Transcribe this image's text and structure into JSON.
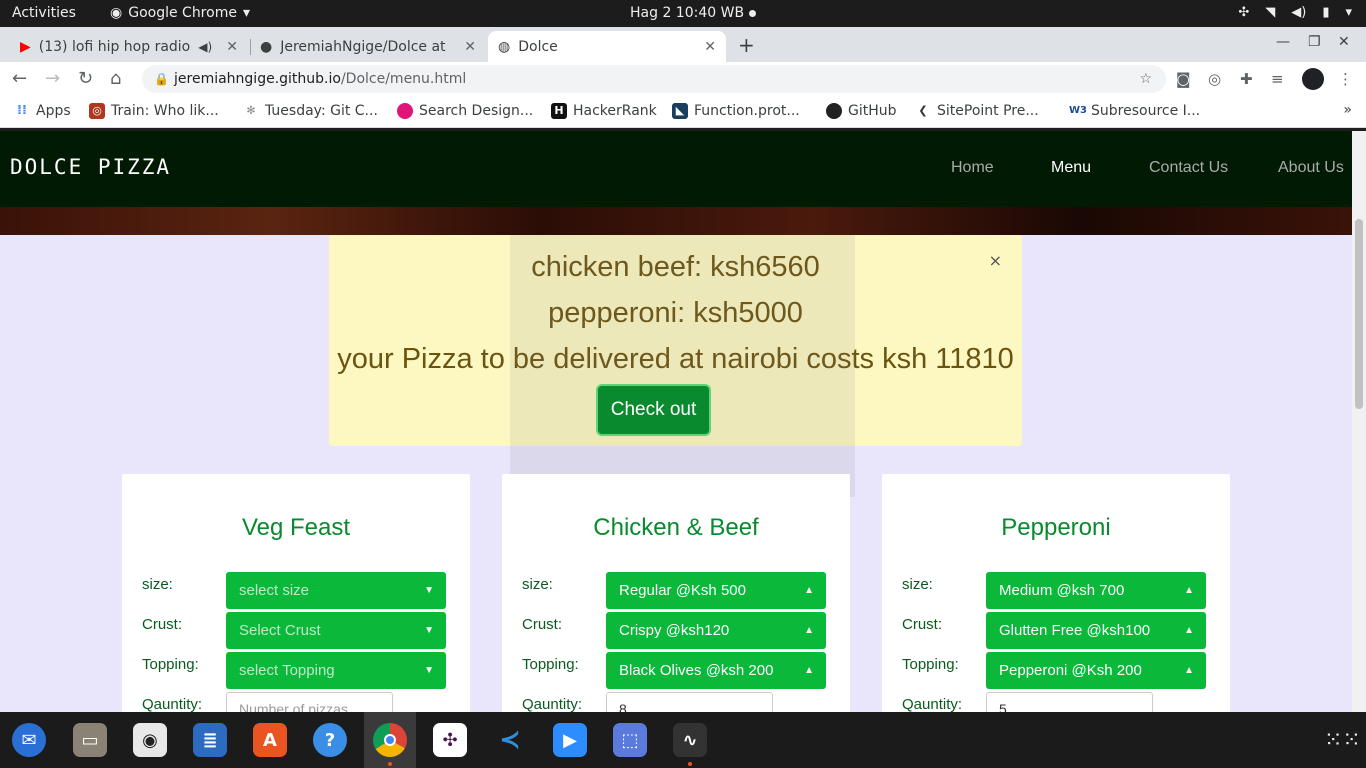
{
  "topbar": {
    "activities": "Activities",
    "app_name": "Google Chrome",
    "clock": "Hag 2  10:40 WB"
  },
  "tabs": [
    {
      "title": "(13) lofi hip hop radio",
      "active": false
    },
    {
      "title": "JeremiahNgige/Dolce at",
      "active": false
    },
    {
      "title": "Dolce",
      "active": true
    }
  ],
  "address": {
    "domain": "jeremiahngige.github.io",
    "path": "/Dolce/menu.html"
  },
  "bookmarks": [
    {
      "label": "Apps",
      "icon": "apps-grid-icon"
    },
    {
      "label": "Train: Who lik...",
      "icon": "codewars-icon"
    },
    {
      "label": "Tuesday: Git C...",
      "icon": "moringa-icon"
    },
    {
      "label": "Search Design...",
      "icon": "dribbble-icon"
    },
    {
      "label": "HackerRank",
      "icon": "hackerrank-icon"
    },
    {
      "label": "Function.prot...",
      "icon": "mdn-icon"
    },
    {
      "label": "GitHub",
      "icon": "github-icon"
    },
    {
      "label": "SitePoint Pre...",
      "icon": "sitepoint-icon"
    },
    {
      "label": "Subresource I...",
      "icon": "w3c-icon"
    }
  ],
  "site": {
    "brand": "DOLCE PIZZA",
    "nav": [
      {
        "label": "Home",
        "active": false
      },
      {
        "label": "Menu",
        "active": true
      },
      {
        "label": "Contact Us",
        "active": false
      },
      {
        "label": "About Us",
        "active": false
      }
    ]
  },
  "alert": {
    "line1": "chicken beef: ksh6560",
    "line2": "pepperoni: ksh5000",
    "line3": "your Pizza to be delivered at nairobi costs ksh 11810",
    "close": "×",
    "checkout": "Check out"
  },
  "labels": {
    "size": "size:",
    "crust": "Crust:",
    "topping": "Topping:",
    "quantity": "Qauntity:"
  },
  "cards": [
    {
      "title": "Veg Feast",
      "size": "select size",
      "crust": "Select Crust",
      "topping": "select Topping",
      "quantity": "Number of pizzas",
      "placeholder": true
    },
    {
      "title": "Chicken & Beef",
      "size": "Regular @Ksh 500",
      "crust": "Crispy @ksh120",
      "topping": "Black Olives @ksh 200",
      "quantity": "8",
      "placeholder": false
    },
    {
      "title": "Pepperoni",
      "size": "Medium @ksh 700",
      "crust": "Glutten Free @ksh100",
      "topping": "Pepperoni @Ksh 200",
      "quantity": "5",
      "placeholder": false
    }
  ]
}
